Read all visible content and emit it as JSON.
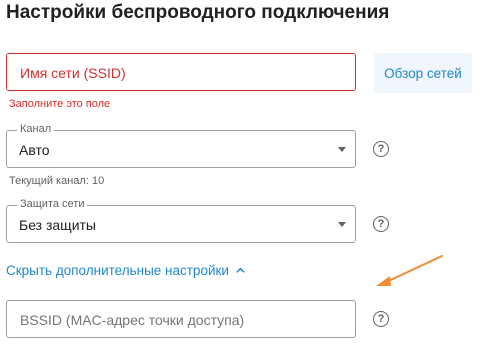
{
  "page": {
    "title": "Настройки беспроводного подключения"
  },
  "ssid": {
    "placeholder": "Имя сети (SSID)",
    "error": "Заполните это поле",
    "browse_label": "Обзор сетей"
  },
  "channel": {
    "label": "Канал",
    "value": "Авто",
    "helper": "Текущий канал: 10"
  },
  "security": {
    "label": "Защита сети",
    "value": "Без защиты"
  },
  "advanced": {
    "toggle_label": "Скрыть дополнительные настройки"
  },
  "bssid": {
    "placeholder": "BSSID (MAC-адрес точки доступа)"
  },
  "help_glyph": "?",
  "icons": {
    "help": "help-circle-icon",
    "caret": "caret-down-icon",
    "chevron": "chevron-up-icon",
    "annotation": "annotation-arrow-icon"
  },
  "colors": {
    "error": "#d32f2f",
    "accent": "#1e88c8",
    "annotation": "#f08c2d"
  }
}
